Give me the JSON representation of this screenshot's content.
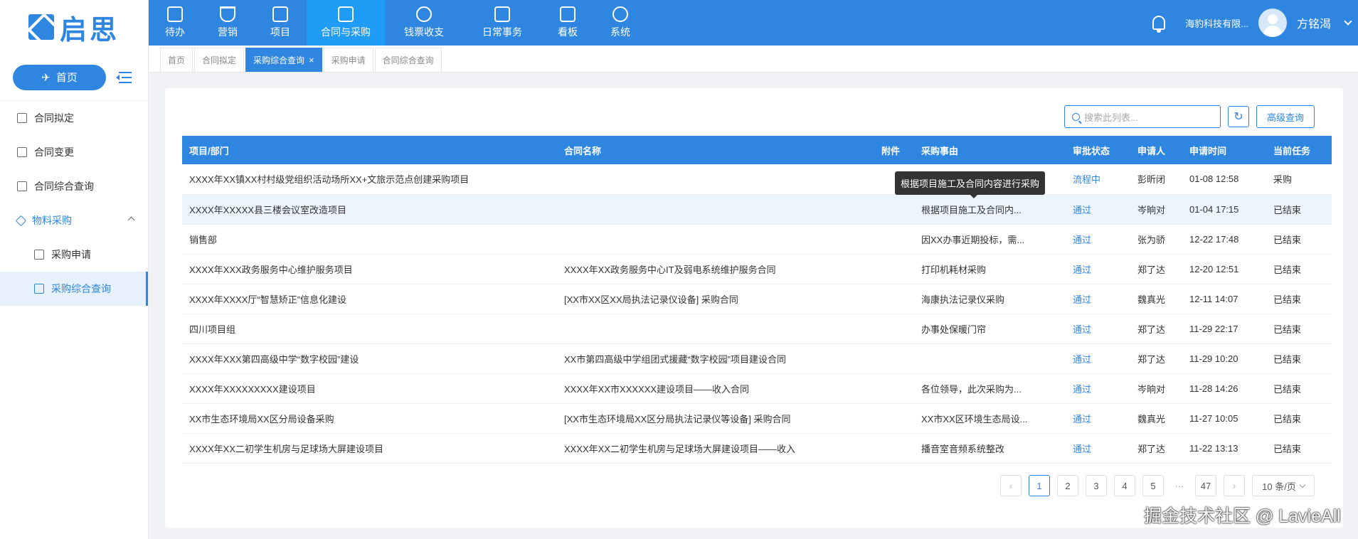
{
  "brand": {
    "logo_text": "启思"
  },
  "sidebar": {
    "home_label": "首页",
    "items": [
      {
        "label": "合同拟定"
      },
      {
        "label": "合同变更"
      },
      {
        "label": "合同综合查询"
      },
      {
        "label": "物料采购"
      },
      {
        "label": "采购申请"
      },
      {
        "label": "采购综合查询"
      }
    ]
  },
  "topnav": {
    "items": [
      {
        "label": "待办"
      },
      {
        "label": "营销"
      },
      {
        "label": "项目"
      },
      {
        "label": "合同与采购"
      },
      {
        "label": "钱票收支"
      },
      {
        "label": "日常事务"
      },
      {
        "label": "看板"
      },
      {
        "label": "系统"
      }
    ],
    "company": "海豹科技有限...",
    "username": "方铭渴"
  },
  "tabs": [
    {
      "label": "首页"
    },
    {
      "label": "合同拟定"
    },
    {
      "label": "采购综合查询"
    },
    {
      "label": "采购申请"
    },
    {
      "label": "合同综合查询"
    }
  ],
  "toolbar": {
    "search_placeholder": "搜索此列表...",
    "advanced_label": "高级查询"
  },
  "table": {
    "headers": [
      "项目/部门",
      "合同名称",
      "附件",
      "采购事由",
      "审批状态",
      "申请人",
      "申请时间",
      "当前任务"
    ],
    "rows": [
      {
        "project": "XXXX年XX镇XX村村级党组织活动场所XX+文旅示范点创建采购项目",
        "contract": "",
        "attach": "",
        "reason": "",
        "status": "流程中",
        "applicant": "彭昕闭",
        "time": "01-08 12:58",
        "task": "采购"
      },
      {
        "project": "XXXX年XXXXX县三楼会议室改造项目",
        "contract": "",
        "attach": "",
        "reason": "根据项目施工及合同内...",
        "status": "通过",
        "applicant": "岑晌对",
        "time": "01-04 17:15",
        "task": "已结束"
      },
      {
        "project": "销售部",
        "contract": "",
        "attach": "",
        "reason": "因XX办事近期投标，需...",
        "status": "通过",
        "applicant": "张为骄",
        "time": "12-22 17:48",
        "task": "已结束"
      },
      {
        "project": "XXXX年XXX政务服务中心维护服务项目",
        "contract": "XXXX年XX政务服务中心IT及弱电系统维护服务合同",
        "attach": "",
        "reason": "打印机耗材采购",
        "status": "通过",
        "applicant": "郑了达",
        "time": "12-20 12:51",
        "task": "已结束"
      },
      {
        "project": "XXXX年XXXX厅“智慧矫正”信息化建设",
        "contract": "[XX市XX区XX局执法记录仪设备] 采购合同",
        "attach": "",
        "reason": "海康执法记录仪采购",
        "status": "通过",
        "applicant": "魏真光",
        "time": "12-11 14:07",
        "task": "已结束"
      },
      {
        "project": "四川项目组",
        "contract": "",
        "attach": "",
        "reason": "办事处保暖门帘",
        "status": "通过",
        "applicant": "郑了达",
        "time": "11-29 22:17",
        "task": "已结束"
      },
      {
        "project": "XXXX年XXX第四高级中学“数字校园”建设",
        "contract": "XX市第四高级中学组团式援藏“数字校园”项目建设合同",
        "attach": "",
        "reason": "",
        "status": "通过",
        "applicant": "郑了达",
        "time": "11-29 10:20",
        "task": "已结束"
      },
      {
        "project": "XXXX年XXXXXXXXX建设项目",
        "contract": "XXXX年XX市XXXXXX建设项目——收入合同",
        "attach": "",
        "reason": "各位领导，此次采购为...",
        "status": "通过",
        "applicant": "岑晌对",
        "time": "11-28 14:26",
        "task": "已结束"
      },
      {
        "project": "XX市生态环境局XX区分局设备采购",
        "contract": "[XX市生态环境局XX区分局执法记录仪等设备] 采购合同",
        "attach": "",
        "reason": "XX市XX区环境生态局设...",
        "status": "通过",
        "applicant": "魏真光",
        "time": "11-27 10:05",
        "task": "已结束"
      },
      {
        "project": "XXXX年XX二初学生机房与足球场大屏建设项目",
        "contract": "XXXX年XX二初学生机房与足球场大屏建设项目——收入",
        "attach": "",
        "reason": "播音室音频系统整改",
        "status": "通过",
        "applicant": "郑了达",
        "time": "11-22 13:13",
        "task": "已结束"
      }
    ]
  },
  "tooltip": {
    "text": "根据项目施工及合同内容进行采购"
  },
  "pagination": {
    "pages": [
      "1",
      "2",
      "3",
      "4",
      "5"
    ],
    "ellipsis": "···",
    "last": "47",
    "page_size": "10 条/页"
  },
  "credit": "掘金技术社区 @ LavieAll"
}
